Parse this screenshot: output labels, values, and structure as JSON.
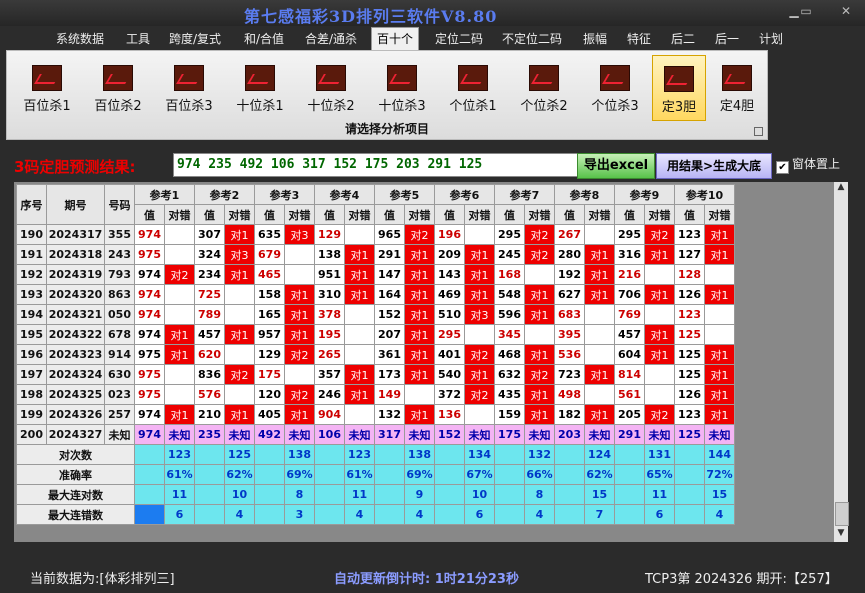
{
  "window": {
    "title": "第七感福彩3D排列三软件V8.80"
  },
  "menu": [
    "系统数据",
    "工具",
    "跨度/复式",
    "和/合值",
    "合差/通杀",
    "百十个",
    "定位二码",
    "不定位二码",
    "振幅",
    "特征",
    "后二",
    "后一",
    "计划"
  ],
  "menu_active": "百十个",
  "ribbon": {
    "buttons": [
      "百位杀1",
      "百位杀2",
      "百位杀3",
      "十位杀1",
      "十位杀2",
      "十位杀3",
      "个位杀1",
      "个位杀2",
      "个位杀3",
      "定3胆",
      "定4胆"
    ],
    "active": "定3胆",
    "caption": "请选择分析项目"
  },
  "predict": {
    "label": "3码定胆预测结果:",
    "value": "974 235 492 106 317 152 175 203 291 125",
    "export_label": "导出excel",
    "gen_label": "用结果>生成大底",
    "ontop_label": "窗体置上",
    "ontop_checked": true
  },
  "table": {
    "headers": {
      "seq": "序号",
      "period": "期号",
      "code": "号码",
      "value": "值",
      "result": "对错"
    },
    "refs": [
      "参考1",
      "参考2",
      "参考3",
      "参考4",
      "参考5",
      "参考6",
      "参考7",
      "参考8",
      "参考9",
      "参考10"
    ],
    "rows": [
      {
        "seq": "190",
        "period": "2024317",
        "code": "355",
        "cells": [
          [
            "974",
            ""
          ],
          [
            "307",
            "对1"
          ],
          [
            "635",
            "对3"
          ],
          [
            "129",
            ""
          ],
          [
            "965",
            "对2"
          ],
          [
            "196",
            ""
          ],
          [
            "295",
            "对2"
          ],
          [
            "267",
            ""
          ],
          [
            "295",
            "对2"
          ],
          [
            "123",
            "对1"
          ]
        ]
      },
      {
        "seq": "191",
        "period": "2024318",
        "code": "243",
        "cells": [
          [
            "975",
            ""
          ],
          [
            "324",
            "对3"
          ],
          [
            "679",
            ""
          ],
          [
            "138",
            "对1"
          ],
          [
            "291",
            "对1"
          ],
          [
            "209",
            "对1"
          ],
          [
            "245",
            "对2"
          ],
          [
            "280",
            "对1"
          ],
          [
            "316",
            "对1"
          ],
          [
            "127",
            "对1"
          ]
        ]
      },
      {
        "seq": "192",
        "period": "2024319",
        "code": "793",
        "cells": [
          [
            "974",
            "对2"
          ],
          [
            "234",
            "对1"
          ],
          [
            "465",
            ""
          ],
          [
            "951",
            "对1"
          ],
          [
            "147",
            "对1"
          ],
          [
            "143",
            "对1"
          ],
          [
            "168",
            ""
          ],
          [
            "192",
            "对1"
          ],
          [
            "216",
            ""
          ],
          [
            "128",
            ""
          ]
        ]
      },
      {
        "seq": "193",
        "period": "2024320",
        "code": "863",
        "cells": [
          [
            "974",
            ""
          ],
          [
            "725",
            ""
          ],
          [
            "158",
            "对1"
          ],
          [
            "310",
            "对1"
          ],
          [
            "164",
            "对1"
          ],
          [
            "469",
            "对1"
          ],
          [
            "548",
            "对1"
          ],
          [
            "627",
            "对1"
          ],
          [
            "706",
            "对1"
          ],
          [
            "126",
            "对1"
          ]
        ]
      },
      {
        "seq": "194",
        "period": "2024321",
        "code": "050",
        "cells": [
          [
            "974",
            ""
          ],
          [
            "789",
            ""
          ],
          [
            "165",
            "对1"
          ],
          [
            "378",
            ""
          ],
          [
            "152",
            "对1"
          ],
          [
            "510",
            "对3"
          ],
          [
            "596",
            "对1"
          ],
          [
            "683",
            ""
          ],
          [
            "769",
            ""
          ],
          [
            "123",
            ""
          ]
        ]
      },
      {
        "seq": "195",
        "period": "2024322",
        "code": "678",
        "cells": [
          [
            "974",
            "对1"
          ],
          [
            "457",
            "对1"
          ],
          [
            "957",
            "对1"
          ],
          [
            "195",
            ""
          ],
          [
            "207",
            "对1"
          ],
          [
            "295",
            ""
          ],
          [
            "345",
            ""
          ],
          [
            "395",
            ""
          ],
          [
            "457",
            "对1"
          ],
          [
            "125",
            ""
          ]
        ]
      },
      {
        "seq": "196",
        "period": "2024323",
        "code": "914",
        "cells": [
          [
            "975",
            "对1"
          ],
          [
            "620",
            ""
          ],
          [
            "129",
            "对2"
          ],
          [
            "265",
            ""
          ],
          [
            "361",
            "对1"
          ],
          [
            "401",
            "对2"
          ],
          [
            "468",
            "对1"
          ],
          [
            "536",
            ""
          ],
          [
            "604",
            "对1"
          ],
          [
            "125",
            "对1"
          ]
        ]
      },
      {
        "seq": "197",
        "period": "2024324",
        "code": "630",
        "cells": [
          [
            "975",
            ""
          ],
          [
            "836",
            "对2"
          ],
          [
            "175",
            ""
          ],
          [
            "357",
            "对1"
          ],
          [
            "173",
            "对1"
          ],
          [
            "540",
            "对1"
          ],
          [
            "632",
            "对2"
          ],
          [
            "723",
            "对1"
          ],
          [
            "814",
            ""
          ],
          [
            "125",
            "对1"
          ]
        ]
      },
      {
        "seq": "198",
        "period": "2024325",
        "code": "023",
        "cells": [
          [
            "975",
            ""
          ],
          [
            "576",
            ""
          ],
          [
            "120",
            "对2"
          ],
          [
            "246",
            "对1"
          ],
          [
            "149",
            ""
          ],
          [
            "372",
            "对2"
          ],
          [
            "435",
            "对1"
          ],
          [
            "498",
            ""
          ],
          [
            "561",
            ""
          ],
          [
            "126",
            "对1"
          ]
        ]
      },
      {
        "seq": "199",
        "period": "2024326",
        "code": "257",
        "cells": [
          [
            "974",
            "对1"
          ],
          [
            "210",
            "对1"
          ],
          [
            "405",
            "对1"
          ],
          [
            "904",
            ""
          ],
          [
            "132",
            "对1"
          ],
          [
            "136",
            ""
          ],
          [
            "159",
            "对1"
          ],
          [
            "182",
            "对1"
          ],
          [
            "205",
            "对2"
          ],
          [
            "123",
            "对1"
          ]
        ]
      }
    ],
    "pending_row": {
      "seq": "200",
      "period": "2024327",
      "code": "未知",
      "values": [
        "974",
        "235",
        "492",
        "106",
        "317",
        "152",
        "175",
        "203",
        "291",
        "125"
      ],
      "unknown": "未知"
    },
    "footer": [
      {
        "label": "对次数",
        "values": [
          "123",
          "125",
          "138",
          "123",
          "138",
          "134",
          "132",
          "124",
          "131",
          "144"
        ]
      },
      {
        "label": "准确率",
        "values": [
          "61%",
          "62%",
          "69%",
          "61%",
          "69%",
          "67%",
          "66%",
          "62%",
          "65%",
          "72%"
        ]
      },
      {
        "label": "最大连对数",
        "values": [
          "11",
          "10",
          "8",
          "11",
          "9",
          "10",
          "8",
          "15",
          "11",
          "15"
        ]
      },
      {
        "label": "最大连错数",
        "values": [
          "6",
          "4",
          "3",
          "4",
          "4",
          "6",
          "4",
          "7",
          "6",
          "4"
        ]
      }
    ]
  },
  "status": {
    "data_source": "当前数据为:[体彩排列三]",
    "countdown": "自动更新倒计时: 1时21分23秒",
    "period_info": "TCP3第 2024326 期开:【257】"
  },
  "colors": {
    "hit": "#ee0000",
    "pending": "#f4b4f4",
    "stats": "#6de6ee",
    "accent": "#1c7cf0"
  }
}
